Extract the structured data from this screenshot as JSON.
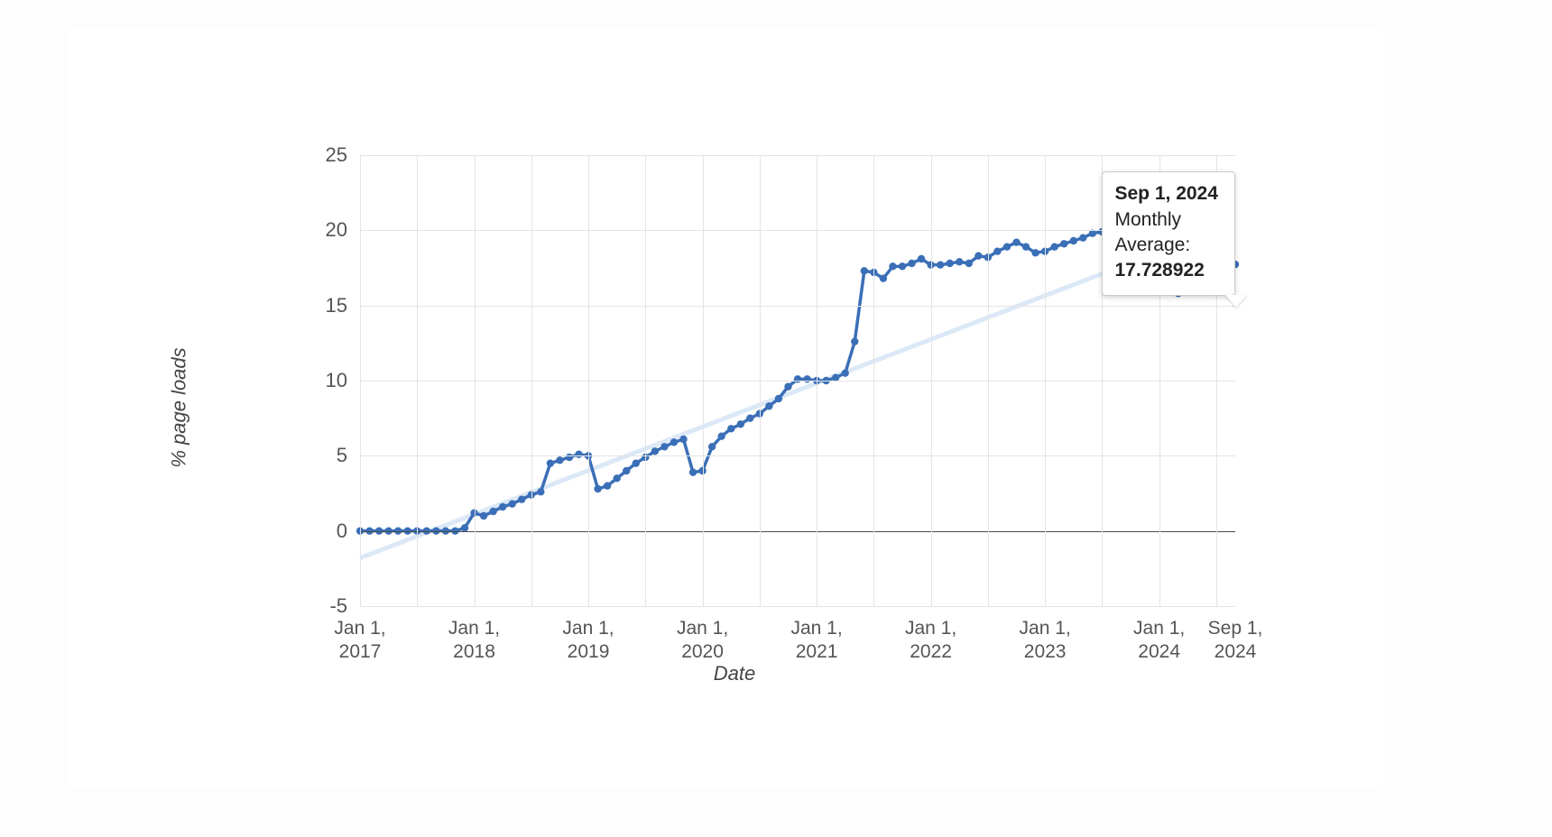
{
  "chart_data": {
    "type": "line",
    "xlabel": "Date",
    "ylabel": "% page loads",
    "ylim": [
      -5,
      25
    ],
    "y_ticks": [
      -5,
      0,
      5,
      10,
      15,
      20,
      25
    ],
    "x_ticks": [
      "Jan 1,\n2017",
      "Jan 1,\n2018",
      "Jan 1,\n2019",
      "Jan 1,\n2020",
      "Jan 1,\n2021",
      "Jan 1,\n2022",
      "Jan 1,\n2023",
      "Jan 1,\n2024",
      "Sep 1,\n2024"
    ],
    "x_tick_positions": [
      0,
      12,
      24,
      36,
      48,
      60,
      72,
      84,
      92
    ],
    "x_range": [
      0,
      92
    ],
    "series": [
      {
        "name": "Monthly Average",
        "x": [
          0,
          1,
          2,
          3,
          4,
          5,
          6,
          7,
          8,
          9,
          10,
          11,
          12,
          13,
          14,
          15,
          16,
          17,
          18,
          19,
          20,
          21,
          22,
          23,
          24,
          25,
          26,
          27,
          28,
          29,
          30,
          31,
          32,
          33,
          34,
          35,
          36,
          37,
          38,
          39,
          40,
          41,
          42,
          43,
          44,
          45,
          46,
          47,
          48,
          49,
          50,
          51,
          52,
          53,
          54,
          55,
          56,
          57,
          58,
          59,
          60,
          61,
          62,
          63,
          64,
          65,
          66,
          67,
          68,
          69,
          70,
          71,
          72,
          73,
          74,
          75,
          76,
          77,
          78,
          79,
          80,
          81,
          82,
          83,
          84,
          85,
          86,
          87,
          88,
          89,
          90,
          91,
          92
        ],
        "values": [
          0.0,
          0.0,
          0.0,
          0.0,
          0.0,
          0.0,
          0.0,
          0.0,
          0.0,
          0.0,
          0.0,
          0.2,
          1.2,
          1.0,
          1.3,
          1.6,
          1.8,
          2.1,
          2.4,
          2.6,
          4.5,
          4.7,
          4.9,
          5.1,
          5.0,
          2.8,
          3.0,
          3.5,
          4.0,
          4.5,
          4.9,
          5.3,
          5.6,
          5.9,
          6.1,
          3.9,
          4.0,
          5.6,
          6.3,
          6.8,
          7.1,
          7.5,
          7.8,
          8.3,
          8.8,
          9.6,
          10.1,
          10.1,
          10.0,
          10.0,
          10.2,
          10.5,
          12.6,
          17.3,
          17.2,
          16.8,
          17.6,
          17.6,
          17.8,
          18.1,
          17.7,
          17.7,
          17.8,
          17.9,
          17.8,
          18.3,
          18.2,
          18.6,
          18.9,
          19.2,
          18.9,
          18.5,
          18.6,
          18.9,
          19.1,
          19.3,
          19.5,
          19.8,
          19.9,
          19.9,
          20.0,
          20.0,
          19.8,
          18.9,
          20.0,
          15.9,
          15.8,
          16.4,
          16.4,
          16.8,
          17.5,
          17.8,
          17.728922
        ]
      }
    ],
    "trendline": {
      "x": [
        0,
        92
      ],
      "y": [
        -1.8,
        20.5
      ]
    },
    "tooltip": {
      "date": "Sep 1, 2024",
      "label": "Monthly Average:",
      "value": "17.728922",
      "anchor_index": 92
    }
  }
}
